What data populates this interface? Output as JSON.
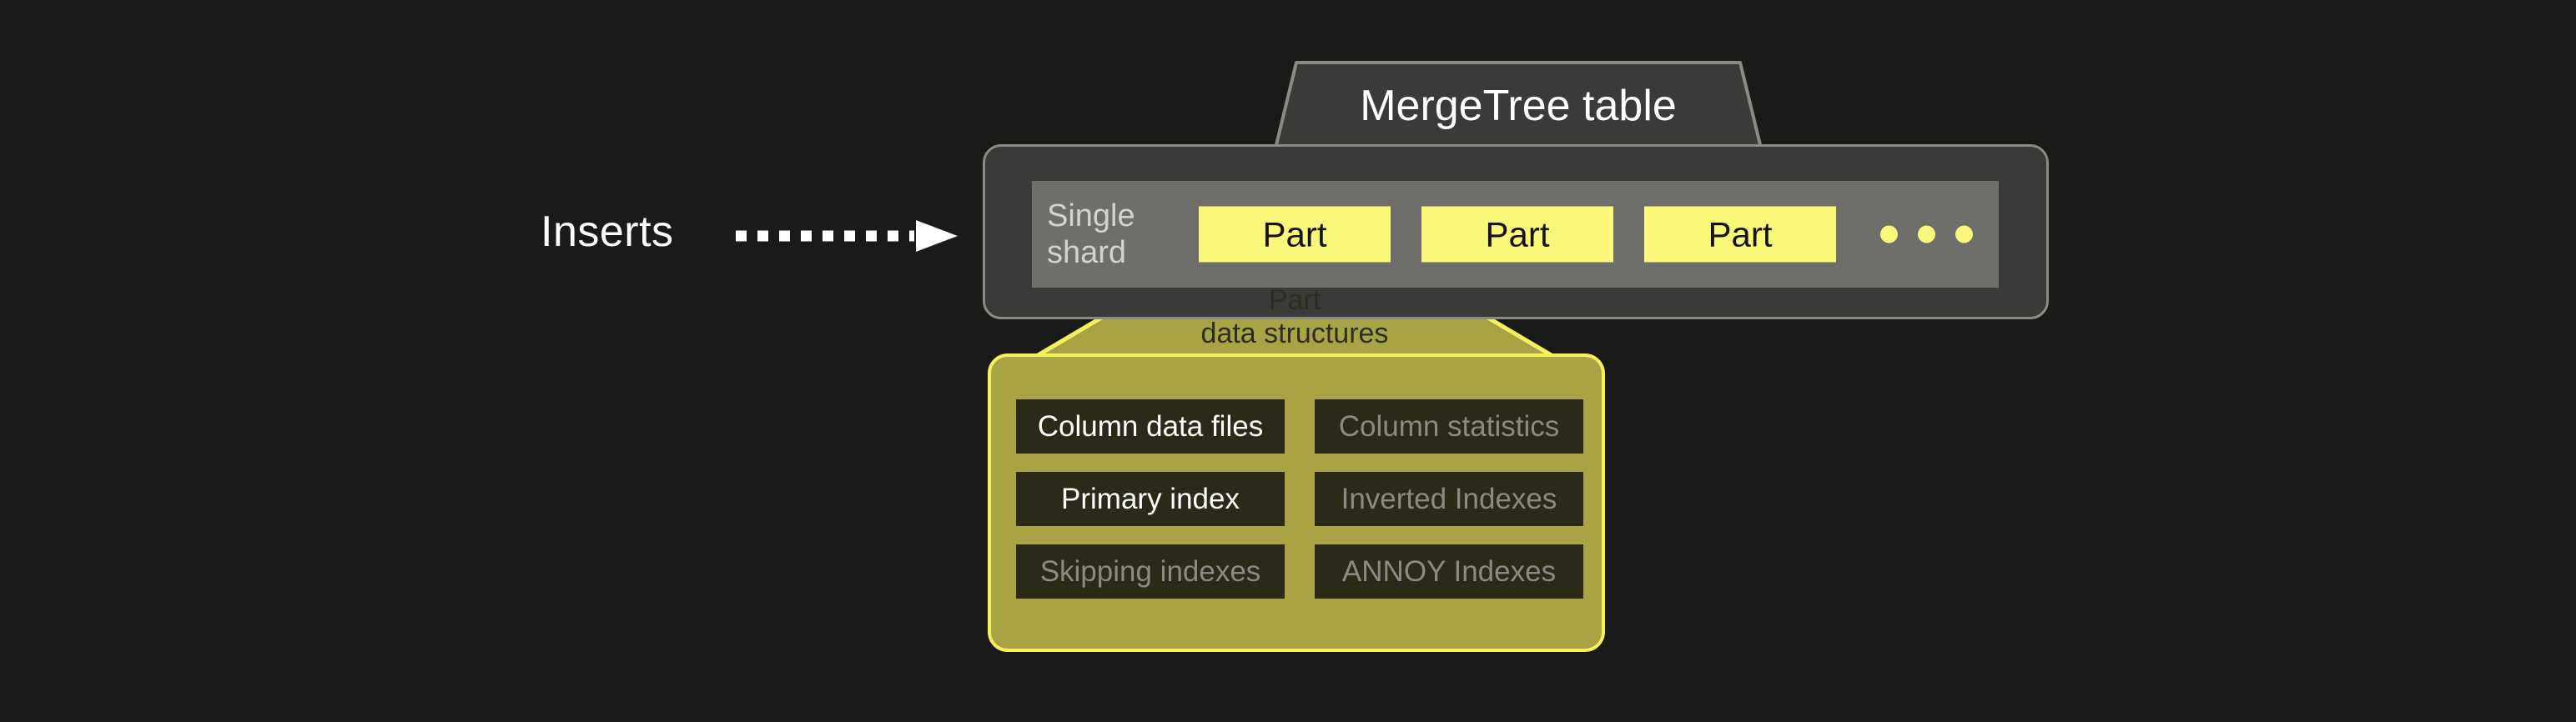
{
  "diagram": {
    "title": "MergeTree table",
    "background_color": "#1a1a19"
  },
  "inserts": {
    "label": "Inserts",
    "arrow_icon": "dotted-right-arrow-icon",
    "arrow_color": "#ffffff"
  },
  "table": {
    "tab_label": "MergeTree table",
    "container_fill": "#3a3a38",
    "container_border": "#8b8b86"
  },
  "shard": {
    "label": "Single\nshard",
    "band_fill": "#6e6e6b",
    "label_color": "#d2d2d0",
    "parts": [
      {
        "label": "Part"
      },
      {
        "label": "Part"
      },
      {
        "label": "Part"
      }
    ],
    "part_fill": "#faf87a",
    "part_text_color": "#141414",
    "ellipsis_icon": "three-dots-icon",
    "ellipsis_count": 3
  },
  "funnel": {
    "label": "Part\ndata structures",
    "fill": "#a8a445",
    "border": "#f5f15a",
    "text_color": "#2e2e20"
  },
  "part_data_structures": {
    "panel_fill": "#a8a445",
    "panel_border": "#f5f15a",
    "cell_fill": "#2b2a18",
    "active_color": "#ffffff",
    "inactive_color": "#8a8a84",
    "items": [
      {
        "label": "Column data files",
        "state": "active"
      },
      {
        "label": "Column statistics",
        "state": "inactive"
      },
      {
        "label": "Primary index",
        "state": "active"
      },
      {
        "label": "Inverted Indexes",
        "state": "inactive"
      },
      {
        "label": "Skipping indexes",
        "state": "inactive"
      },
      {
        "label": "ANNOY Indexes",
        "state": "inactive"
      }
    ]
  }
}
